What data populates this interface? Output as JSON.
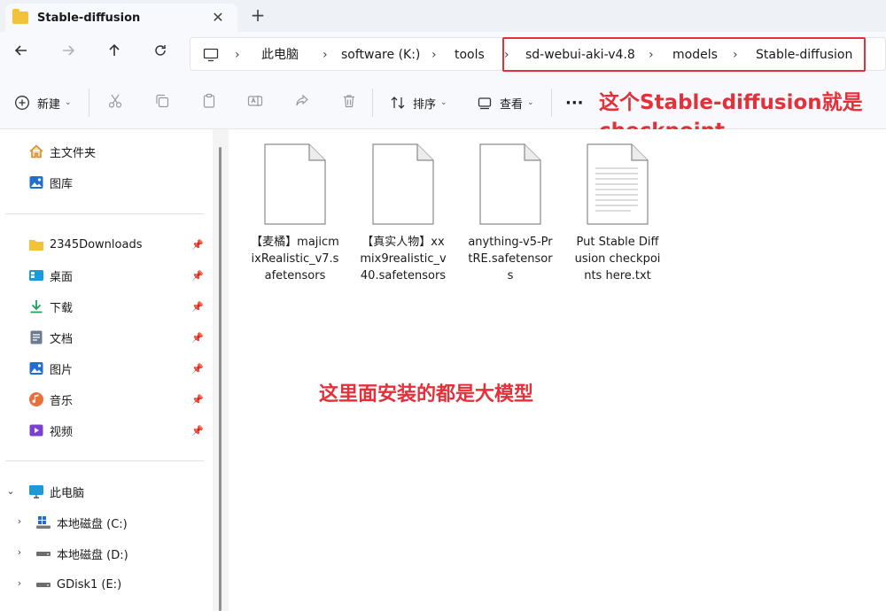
{
  "tab": {
    "title": "Stable-diffusion"
  },
  "address": {
    "root": "此电脑",
    "segments": [
      "software (K:)",
      "tools",
      "sd-webui-aki-v4.8",
      "models",
      "Stable-diffusion"
    ]
  },
  "toolbar": {
    "new_label": "新建",
    "sort_label": "排序",
    "view_label": "查看",
    "more_label": "···"
  },
  "annotations": {
    "top_line1": "这个Stable-diffusion就是",
    "top_line2": "checkpoint",
    "middle": "这里面安装的都是大模型"
  },
  "sidebar": {
    "home": "主文件夹",
    "gallery": "图库",
    "pinned": [
      {
        "label": "2345Downloads",
        "icon": "folder-icon"
      },
      {
        "label": "桌面",
        "icon": "desktop-icon"
      },
      {
        "label": "下载",
        "icon": "download-icon"
      },
      {
        "label": "文档",
        "icon": "document-icon"
      },
      {
        "label": "图片",
        "icon": "pictures-icon"
      },
      {
        "label": "音乐",
        "icon": "music-icon"
      },
      {
        "label": "视频",
        "icon": "video-icon"
      }
    ],
    "this_pc": "此电脑",
    "drives": [
      {
        "label": "本地磁盘 (C:)"
      },
      {
        "label": "本地磁盘 (D:)"
      },
      {
        "label": "GDisk1 (E:)"
      }
    ]
  },
  "files": [
    {
      "name": "【麦橘】majicmixRealistic_v7.safetensors",
      "type": "blank"
    },
    {
      "name": "【真实人物】xxmix9realistic_v40.safetensors",
      "type": "blank"
    },
    {
      "name": "anything-v5-PrtRE.safetensors",
      "type": "blank"
    },
    {
      "name": "Put Stable Diffusion checkpoints here.txt",
      "type": "text"
    }
  ],
  "colors": {
    "annotation": "#e5303a",
    "folder": "#f4c13a",
    "accent_blue": "#1f6fd1"
  }
}
